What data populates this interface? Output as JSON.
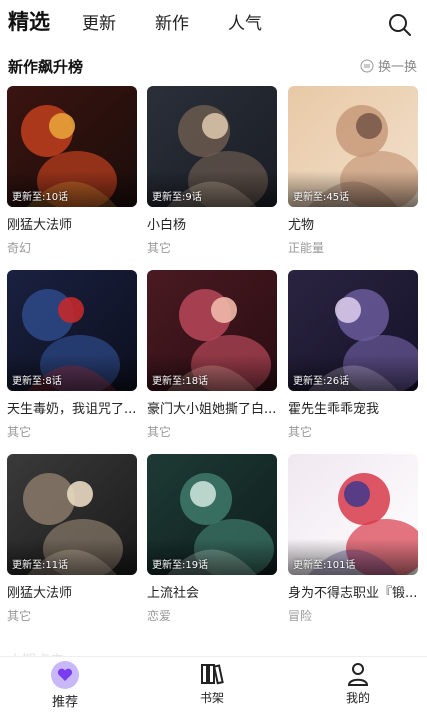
{
  "tabs": [
    {
      "label": "精选",
      "active": true
    },
    {
      "label": "更新",
      "active": false
    },
    {
      "label": "新作",
      "active": false
    },
    {
      "label": "人气",
      "active": false
    }
  ],
  "section": {
    "title": "新作飙升榜",
    "refresh_label": "换一换"
  },
  "cards": [
    {
      "title": "刚猛大法师",
      "genre": "奇幻",
      "badge": "更新至:10话",
      "palette": [
        "#3a1410",
        "#c2401f",
        "#e8a23a",
        "#1b0d0a"
      ]
    },
    {
      "title": "小白杨",
      "genre": "其它",
      "badge": "更新至:9话",
      "palette": [
        "#2a2f3a",
        "#6b5a4e",
        "#d7c3a8",
        "#1a1d24"
      ]
    },
    {
      "title": "尤物",
      "genre": "正能量",
      "badge": "更新至:45话",
      "palette": [
        "#e8c9a6",
        "#c89a7a",
        "#7a5a4a",
        "#f2e0cc"
      ]
    },
    {
      "title": "天生毒奶，我诅咒了...",
      "genre": "其它",
      "badge": "更新至:8话",
      "palette": [
        "#1a2140",
        "#2e4a8a",
        "#c2292c",
        "#0c0f1e"
      ]
    },
    {
      "title": "豪门大小姐她撕了白...",
      "genre": "其它",
      "badge": "更新至:18话",
      "palette": [
        "#4a1a22",
        "#b8485a",
        "#f0b8a8",
        "#2a0d12"
      ]
    },
    {
      "title": "霍先生乖乖宠我",
      "genre": "其它",
      "badge": "更新至:26话",
      "palette": [
        "#2a2440",
        "#6a5a9a",
        "#d8c8e8",
        "#16122a"
      ]
    },
    {
      "title": "刚猛大法师",
      "genre": "其它",
      "badge": "更新至:11话",
      "palette": [
        "#3a3a3a",
        "#8a7a6a",
        "#e8d8c0",
        "#1a1a1a"
      ]
    },
    {
      "title": "上流社会",
      "genre": "恋爱",
      "badge": "更新至:19话",
      "palette": [
        "#1e3a36",
        "#3e7a6a",
        "#c8e0d8",
        "#0e1e1c"
      ]
    },
    {
      "title": "身为不得志职业『锻...",
      "genre": "冒险",
      "badge": "更新至:101话",
      "palette": [
        "#f0e8f0",
        "#d83a4a",
        "#4a3a8a",
        "#ffffff"
      ]
    }
  ],
  "peek_text": "本期点击",
  "bottom_nav": [
    {
      "label": "推荐",
      "active": true
    },
    {
      "label": "书架",
      "active": false
    },
    {
      "label": "我的",
      "active": false
    }
  ],
  "colors": {
    "accent": "#8a5cf0",
    "accent_soft": "#c9b8f7",
    "text": "#222222",
    "muted": "#999999"
  },
  "icons": {
    "search": "search-icon",
    "refresh": "refresh-icon",
    "home": "heart-icon",
    "shelf": "books-icon",
    "profile": "person-icon"
  }
}
